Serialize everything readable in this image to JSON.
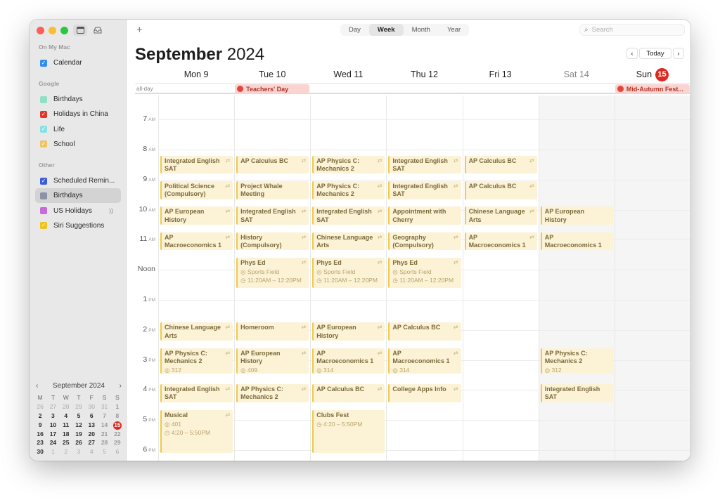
{
  "sidebar": {
    "sections": [
      {
        "label": "On My Mac",
        "items": [
          {
            "label": "Calendar",
            "color": "#2f8cf4",
            "checked": true
          }
        ]
      },
      {
        "label": "Google",
        "items": [
          {
            "label": "Birthdays",
            "color": "#8ee0c6",
            "checked": false
          },
          {
            "label": "Holidays in China",
            "color": "#e2342b",
            "checked": true
          },
          {
            "label": "Life",
            "color": "#8bdfe4",
            "checked": true
          },
          {
            "label": "School",
            "color": "#f0c462",
            "checked": true
          }
        ]
      },
      {
        "label": "Other",
        "items": [
          {
            "label": "Scheduled Remin...",
            "color": "#3b5fd9",
            "checked": true
          },
          {
            "label": "Birthdays",
            "color": "#8a94a6",
            "checked": false
          },
          {
            "label": "US Holidays",
            "color": "#c86bd8",
            "checked": false,
            "extra": "broadcast-icon"
          },
          {
            "label": "Siri Suggestions",
            "color": "#f0c21c",
            "checked": true
          }
        ]
      }
    ],
    "mini_calendar": {
      "title": "September 2024",
      "prev": "‹",
      "next": "›",
      "weekdays": [
        "M",
        "T",
        "W",
        "T",
        "F",
        "S",
        "S"
      ],
      "weeks": [
        [
          "26",
          "27",
          "28",
          "29",
          "30",
          "31",
          "1"
        ],
        [
          "2",
          "3",
          "4",
          "5",
          "6",
          "7",
          "8"
        ],
        [
          "9",
          "10",
          "11",
          "12",
          "13",
          "14",
          "15"
        ],
        [
          "16",
          "17",
          "18",
          "19",
          "20",
          "21",
          "22"
        ],
        [
          "23",
          "24",
          "25",
          "26",
          "27",
          "28",
          "29"
        ],
        [
          "30",
          "1",
          "2",
          "3",
          "4",
          "5",
          "6"
        ]
      ],
      "today": "15"
    }
  },
  "toolbar": {
    "add_label": "+",
    "views": [
      "Day",
      "Week",
      "Month",
      "Year"
    ],
    "active_view": "Week",
    "search_placeholder": "Search",
    "prev": "‹",
    "today_label": "Today",
    "next": "›"
  },
  "header": {
    "month": "September",
    "year": "2024"
  },
  "days": [
    {
      "label": "Mon 9"
    },
    {
      "label": "Tue 10"
    },
    {
      "label": "Wed 11"
    },
    {
      "label": "Thu 12"
    },
    {
      "label": "Fri 13"
    },
    {
      "label": "Sat 14",
      "weekend": true
    },
    {
      "label": "Sun",
      "badge": "15",
      "weekend": true
    }
  ],
  "allday": {
    "label": "all-day",
    "events": [
      {
        "day": 1,
        "title": "Teachers' Day"
      },
      {
        "day": 6,
        "title": "Mid-Autumn Fest..."
      }
    ]
  },
  "hours": [
    {
      "h": "7",
      "ampm": "AM"
    },
    {
      "h": "8",
      "ampm": "AM"
    },
    {
      "h": "9",
      "ampm": "AM"
    },
    {
      "h": "10",
      "ampm": "AM"
    },
    {
      "h": "11",
      "ampm": "AM"
    },
    {
      "h": "Noon",
      "ampm": ""
    },
    {
      "h": "1",
      "ampm": "PM"
    },
    {
      "h": "2",
      "ampm": "PM"
    },
    {
      "h": "3",
      "ampm": "PM"
    },
    {
      "h": "4",
      "ampm": "PM"
    },
    {
      "h": "5",
      "ampm": "PM"
    },
    {
      "h": "6",
      "ampm": "PM"
    }
  ],
  "events": [
    {
      "day": 0,
      "start": 8.2,
      "end": 8.8,
      "title": "Integrated English SAT",
      "repeat": true
    },
    {
      "day": 0,
      "start": 9.05,
      "end": 9.65,
      "title": "Political Science (Compulsory)",
      "repeat": true
    },
    {
      "day": 0,
      "start": 9.9,
      "end": 10.5,
      "title": "AP European History",
      "repeat": true
    },
    {
      "day": 0,
      "start": 10.75,
      "end": 11.35,
      "title": "AP Macroeconomics 1",
      "repeat": true
    },
    {
      "day": 0,
      "start": 13.75,
      "end": 14.35,
      "title": "Chinese Language Arts",
      "repeat": true
    },
    {
      "day": 0,
      "start": 14.6,
      "end": 15.45,
      "title": "AP Physics C: Mechanics 2",
      "room": "312",
      "repeat": true
    },
    {
      "day": 0,
      "start": 15.8,
      "end": 16.4,
      "title": "Integrated English SAT",
      "repeat": true
    },
    {
      "day": 0,
      "start": 16.67,
      "end": 18.1,
      "title": "Musical",
      "room": "401",
      "time": "4:20 – 5:50PM",
      "repeat": true
    },
    {
      "day": 1,
      "start": 8.2,
      "end": 8.8,
      "title": "AP Calculus BC",
      "repeat": true
    },
    {
      "day": 1,
      "start": 9.05,
      "end": 9.65,
      "title": "Project Whale Meeting",
      "repeat": false
    },
    {
      "day": 1,
      "start": 9.9,
      "end": 10.5,
      "title": "Integrated English SAT",
      "repeat": true
    },
    {
      "day": 1,
      "start": 10.75,
      "end": 11.35,
      "title": "History (Compulsory)",
      "repeat": true
    },
    {
      "day": 1,
      "start": 11.6,
      "end": 12.6,
      "title": "Phys Ed",
      "room": "Sports Field",
      "time": "11:20AM – 12:20PM",
      "repeat": true
    },
    {
      "day": 1,
      "start": 13.75,
      "end": 14.35,
      "title": "Homeroom",
      "repeat": true
    },
    {
      "day": 1,
      "start": 14.6,
      "end": 15.45,
      "title": "AP European History",
      "room": "409",
      "repeat": true
    },
    {
      "day": 1,
      "start": 15.8,
      "end": 16.4,
      "title": "AP Physics C: Mechanics 2",
      "repeat": true
    },
    {
      "day": 2,
      "start": 8.2,
      "end": 8.8,
      "title": "AP Physics C: Mechanics 2",
      "repeat": true
    },
    {
      "day": 2,
      "start": 9.05,
      "end": 9.65,
      "title": "AP Physics C: Mechanics 2",
      "repeat": true
    },
    {
      "day": 2,
      "start": 9.9,
      "end": 10.5,
      "title": "Integrated English SAT",
      "repeat": true
    },
    {
      "day": 2,
      "start": 10.75,
      "end": 11.35,
      "title": "Chinese Language Arts",
      "repeat": true
    },
    {
      "day": 2,
      "start": 11.6,
      "end": 12.6,
      "title": "Phys Ed",
      "room": "Sports Field",
      "time": "11:20AM – 12:20PM",
      "repeat": true
    },
    {
      "day": 2,
      "start": 13.75,
      "end": 14.35,
      "title": "AP European History",
      "repeat": true
    },
    {
      "day": 2,
      "start": 14.6,
      "end": 15.45,
      "title": "AP Macroeconomics 1",
      "room": "314",
      "repeat": true
    },
    {
      "day": 2,
      "start": 15.8,
      "end": 16.4,
      "title": "AP Calculus BC",
      "repeat": true
    },
    {
      "day": 2,
      "start": 16.67,
      "end": 18.1,
      "title": "Clubs Fest",
      "time": "4:20 – 5:50PM",
      "repeat": false
    },
    {
      "day": 3,
      "start": 8.2,
      "end": 8.8,
      "title": "Integrated English SAT",
      "repeat": true
    },
    {
      "day": 3,
      "start": 9.05,
      "end": 9.65,
      "title": "Integrated English SAT",
      "repeat": true
    },
    {
      "day": 3,
      "start": 9.9,
      "end": 10.5,
      "title": "Appointment with Cherry",
      "repeat": false
    },
    {
      "day": 3,
      "start": 10.75,
      "end": 11.35,
      "title": "Geography (Compulsory)",
      "repeat": true
    },
    {
      "day": 3,
      "start": 11.6,
      "end": 12.6,
      "title": "Phys Ed",
      "room": "Sports Field",
      "time": "11:20AM – 12:20PM",
      "repeat": true
    },
    {
      "day": 3,
      "start": 13.75,
      "end": 14.35,
      "title": "AP Calculus BC",
      "repeat": true
    },
    {
      "day": 3,
      "start": 14.6,
      "end": 15.45,
      "title": "AP Macroeconomics 1",
      "room": "314",
      "repeat": true
    },
    {
      "day": 3,
      "start": 15.8,
      "end": 16.4,
      "title": "College Apps Info",
      "repeat": true
    },
    {
      "day": 4,
      "start": 8.2,
      "end": 8.8,
      "title": "AP Calculus BC",
      "repeat": true
    },
    {
      "day": 4,
      "start": 9.05,
      "end": 9.65,
      "title": "AP Calculus BC",
      "repeat": true
    },
    {
      "day": 4,
      "start": 9.9,
      "end": 10.5,
      "title": "Chinese Language Arts",
      "repeat": true
    },
    {
      "day": 4,
      "start": 10.75,
      "end": 11.35,
      "title": "AP Macroeconomics 1",
      "repeat": true
    },
    {
      "day": 5,
      "start": 9.9,
      "end": 10.5,
      "title": "AP European History",
      "repeat": false
    },
    {
      "day": 5,
      "start": 10.75,
      "end": 11.35,
      "title": "AP Macroeconomics 1",
      "repeat": false
    },
    {
      "day": 5,
      "start": 14.6,
      "end": 15.45,
      "title": "AP Physics C: Mechanics 2",
      "room": "312",
      "repeat": false
    },
    {
      "day": 5,
      "start": 15.8,
      "end": 16.4,
      "title": "Integrated English SAT",
      "repeat": false
    }
  ]
}
